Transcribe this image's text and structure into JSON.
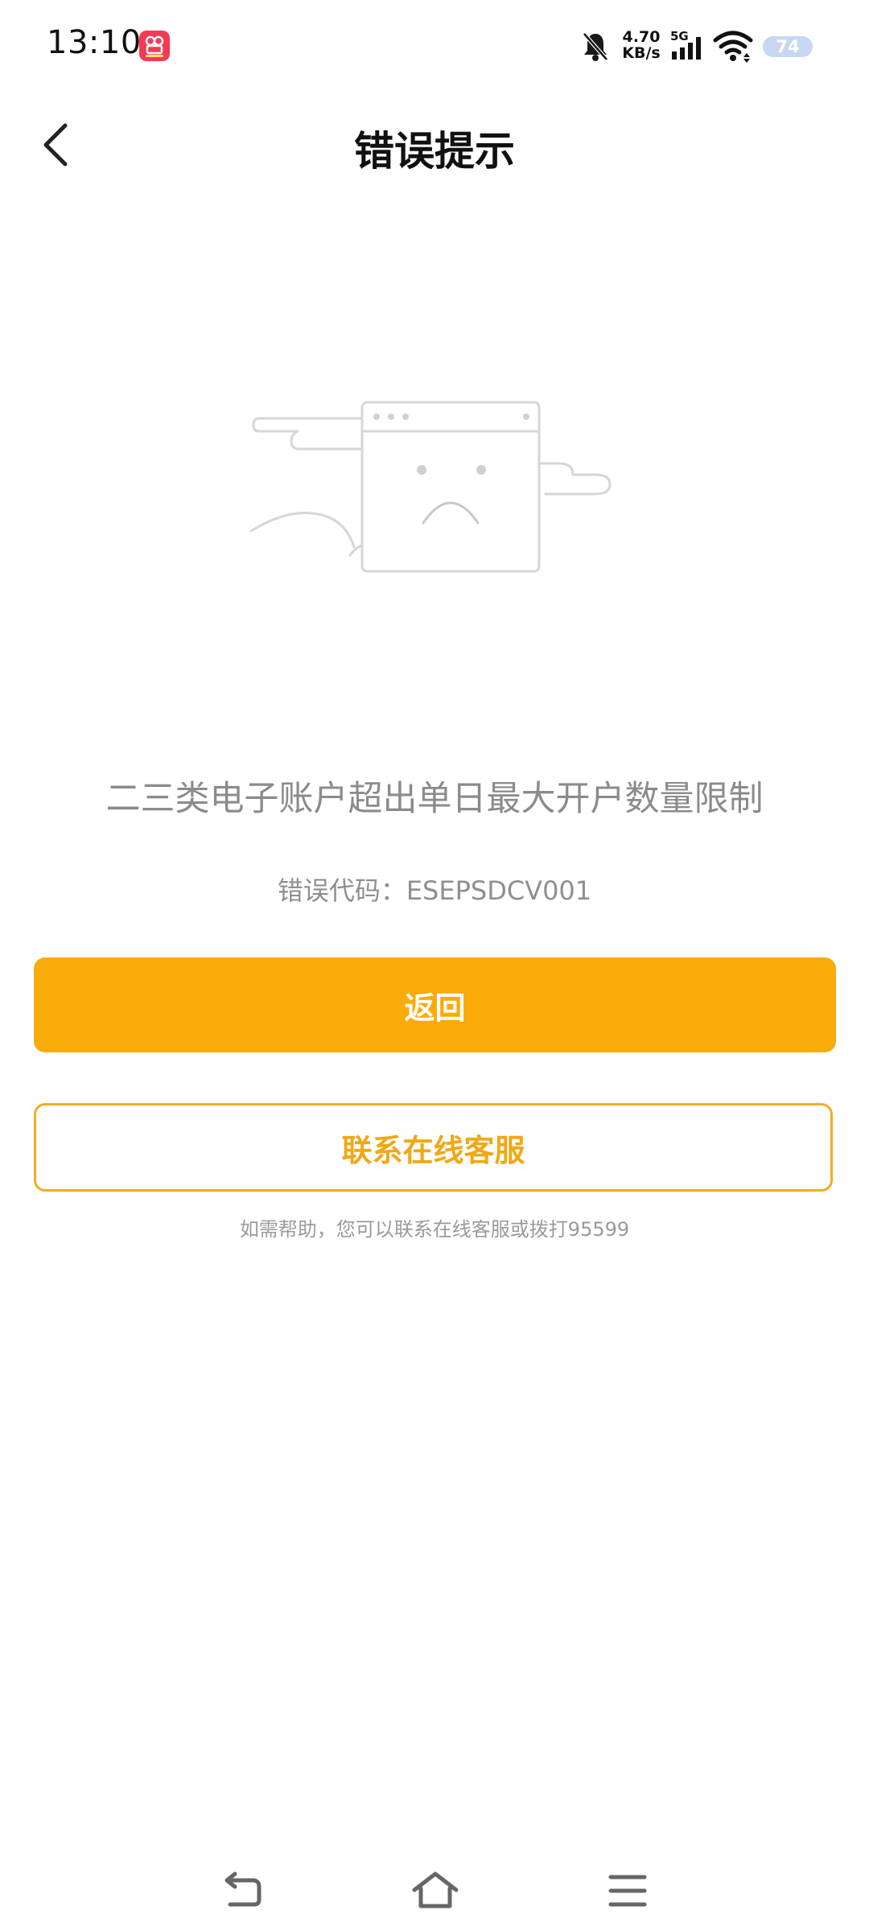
{
  "status_bar": {
    "time": "13:10",
    "net_speed_value": "4.70",
    "net_speed_unit": "KB/s",
    "network_type": "5G",
    "battery": "74",
    "icons": [
      "app-notification-icon",
      "mute-icon",
      "5g-signal-icon",
      "wifi-icon",
      "battery-icon"
    ]
  },
  "header": {
    "title": "错误提示",
    "back_icon": "chevron-left-icon"
  },
  "illustration": {
    "icon": "sad-browser-window-icon"
  },
  "error": {
    "message": "二三类电子账户超出单日最大开户数量限制",
    "code_text": "错误代码：ESEPSDCV001"
  },
  "actions": {
    "primary_label": "返回",
    "secondary_label": "联系在线客服",
    "help_text": "如需帮助，您可以联系在线客服或拨打95599"
  },
  "colors": {
    "accent": "#f9ab0a",
    "accent_text": "#f0a816",
    "muted_text": "#8b8b8b"
  },
  "nav_bar": {
    "icons": [
      "back-nav-icon",
      "home-nav-icon",
      "menu-nav-icon"
    ]
  }
}
